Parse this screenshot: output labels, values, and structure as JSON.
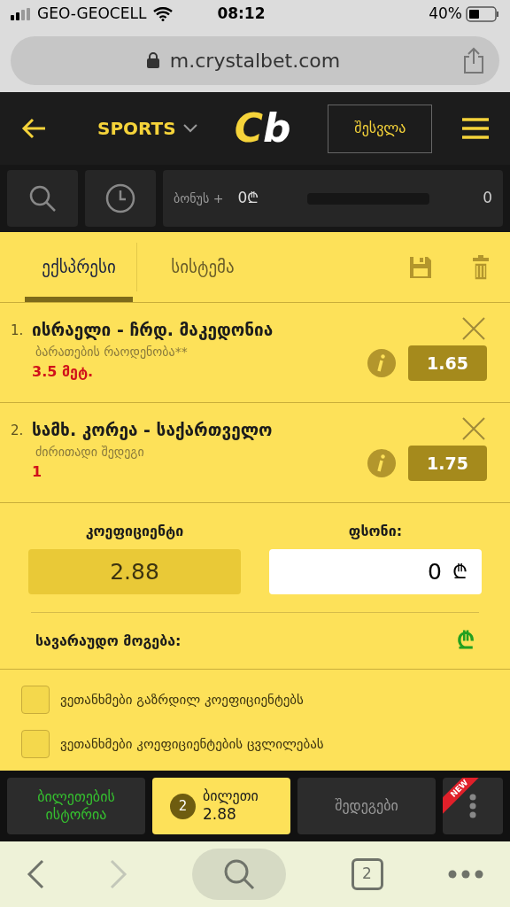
{
  "status_bar": {
    "carrier": "GEO-GEOCELL",
    "time": "08:12",
    "battery": "40%"
  },
  "browser": {
    "url": "m.crystalbet.com",
    "tab_count": "2"
  },
  "header": {
    "section": "SPORTS",
    "logo_left": "C",
    "logo_right": "b",
    "login": "შესვლა"
  },
  "toolbar": {
    "bonus_label": "ბონუს +",
    "bonus_value": "0₾",
    "count": "0"
  },
  "tabs": [
    {
      "label": "ექსპრესი",
      "selected": true
    },
    {
      "label": "სისტემა",
      "selected": false
    }
  ],
  "bets": [
    {
      "number": "1.",
      "match": "ისრაელი - ჩრდ. მაკედონია",
      "market": "ბარათების რაოდენობა**",
      "pick": "3.5 მეტ.",
      "odds": "1.65"
    },
    {
      "number": "2.",
      "match": "სამხ. კორეა - საქართველო",
      "market": "ძირითადი შედეგი",
      "pick": "1",
      "odds": "1.75"
    }
  ],
  "totals": {
    "coef_label": "კოეფიციენტი",
    "coef_value": "2.88",
    "stake_label": "ფსონი:",
    "stake_value": "0",
    "stake_currency": "₾",
    "win_label": "სავარაუდო მოგება:",
    "win_currency": "₾"
  },
  "options": [
    {
      "label": "ვეთანხმები გაზრდილ კოეფიციენტებს",
      "checked": false
    },
    {
      "label": "ვეთანხმები კოეფიციენტების ცვლილებას",
      "checked": false
    }
  ],
  "bottom_nav": [
    {
      "kind": "text",
      "label": "ბილეთების ისტორია",
      "selected": false
    },
    {
      "kind": "ticket",
      "badge": "2",
      "label": "ბილეთი",
      "value": "2.88",
      "selected": true
    },
    {
      "kind": "text",
      "label": "შედეგები",
      "selected": false
    },
    {
      "kind": "more",
      "ribbon": "NEW",
      "selected": false
    }
  ]
}
